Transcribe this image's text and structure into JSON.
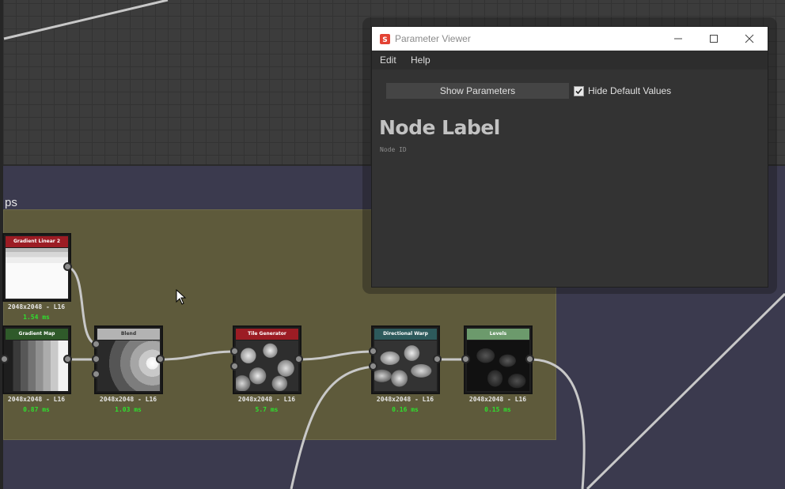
{
  "frame": {
    "label": "ps"
  },
  "nodes": [
    {
      "key": "gradient-linear-2",
      "title": "Gradient Linear 2",
      "resolution": "2048x2048 - L16",
      "time": "1.54 ms",
      "header_color": "#9c1c24"
    },
    {
      "key": "gradient-map",
      "title": "Gradient Map",
      "resolution": "2048x2048 - L16",
      "time": "0.87 ms",
      "header_color": "#2f5a2a"
    },
    {
      "key": "blend",
      "title": "Blend",
      "resolution": "2048x2048 - L16",
      "time": "1.03 ms",
      "header_color": "#b3b3b3"
    },
    {
      "key": "tile-generator",
      "title": "Tile Generator",
      "resolution": "2048x2048 - L16",
      "time": "5.7 ms",
      "header_color": "#9c1c24"
    },
    {
      "key": "directional-warp",
      "title": "Directional Warp",
      "resolution": "2048x2048 - L16",
      "time": "0.16 ms",
      "header_color": "#2d5a5c"
    },
    {
      "key": "levels",
      "title": "Levels",
      "resolution": "2048x2048 - L16",
      "time": "0.15 ms",
      "header_color": "#6c9a6c"
    }
  ],
  "parameter_viewer": {
    "title": "Parameter Viewer",
    "menus": [
      "Edit",
      "Help"
    ],
    "show_parameters_label": "Show Parameters",
    "hide_default_values_label": "Hide Default Values",
    "hide_default_values_checked": true,
    "node_label": "Node Label",
    "node_id": "Node ID",
    "controls": [
      "minimize-icon",
      "maximize-icon",
      "close-icon"
    ]
  },
  "colors": {
    "accent_time": "#2ee02e",
    "app_icon": "#e34234"
  }
}
